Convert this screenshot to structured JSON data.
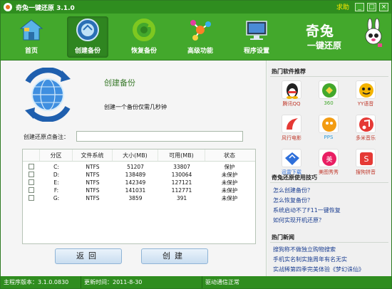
{
  "window": {
    "title": "奇兔一键还原 3.1.0",
    "help": "求助"
  },
  "window_buttons": [
    "_",
    "□",
    "×"
  ],
  "toolbar": {
    "items": [
      {
        "label": "首页",
        "icon": "home-icon"
      },
      {
        "label": "创建备份",
        "icon": "backup-create-icon"
      },
      {
        "label": "恢复备份",
        "icon": "restore-icon"
      },
      {
        "label": "高级功能",
        "icon": "advanced-icon"
      },
      {
        "label": "程序设置",
        "icon": "settings-monitor-icon"
      }
    ],
    "active": "创建备份",
    "brand_line1": "奇兔",
    "brand_line2": "一键还原"
  },
  "main": {
    "title": "创建备份",
    "description": "创建一个备份仅需几秒钟",
    "note_label": "创建还原点备注：",
    "note_value": "",
    "table": {
      "headers": [
        "",
        "分区",
        "文件系统",
        "大小(MB)",
        "可用(MB)",
        "状态"
      ],
      "rows": [
        {
          "drive": "C:",
          "fs": "NTFS",
          "size": "51207",
          "free": "33807",
          "status": "保护"
        },
        {
          "drive": "D:",
          "fs": "NTFS",
          "size": "138489",
          "free": "130064",
          "status": "未保护"
        },
        {
          "drive": "E:",
          "fs": "NTFS",
          "size": "142349",
          "free": "127121",
          "status": "未保护"
        },
        {
          "drive": "F:",
          "fs": "NTFS",
          "size": "141031",
          "free": "112771",
          "status": "未保护"
        },
        {
          "drive": "G:",
          "fs": "NTFS",
          "size": "3859",
          "free": "391",
          "status": "未保护"
        }
      ]
    },
    "back_button": "返回",
    "create_button": "创建"
  },
  "sidebar": {
    "hot_software_title": "热门软件推荐",
    "software": [
      {
        "label": "腾讯QQ",
        "color": "#e53935"
      },
      {
        "label": "360",
        "color": "#43a82c"
      },
      {
        "label": "YY语音",
        "color": "#f4b400"
      },
      {
        "label": "风行电影",
        "color": "#e53935"
      },
      {
        "label": "PPS",
        "color": "#2e9cda"
      },
      {
        "label": "多米音乐",
        "color": "#e53935"
      },
      {
        "label": "迅雷下载",
        "color": "#2e6fda"
      },
      {
        "label": "美图秀秀",
        "color": "#e91e63"
      },
      {
        "label": "搜狗拼音",
        "color": "#e53935"
      }
    ],
    "tips_title": "奇兔还原使用技巧",
    "tips": [
      "怎么创建备份？",
      "怎么恢复备份？",
      "系统启动不了F11一键恢复",
      "如何实现开机还原？"
    ],
    "news_title": "热门新闻",
    "news": [
      "搜狗称不做独立购物搜索",
      "手机实名制实施周年有名无实",
      "实战稀第四季完美体验《梦幻诛仙》"
    ]
  },
  "statusbar": {
    "version": "主程序版本：3.1.0.0830",
    "updated": "更新时间：2011-8-30",
    "driver": "驱动通信正常"
  }
}
